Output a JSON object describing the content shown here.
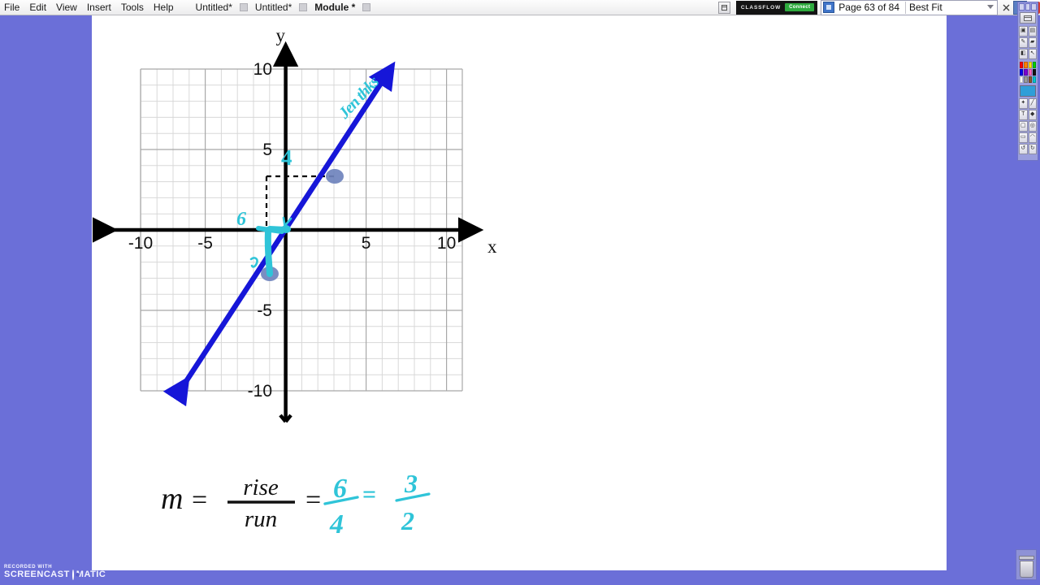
{
  "window": {
    "menus": [
      "File",
      "Edit",
      "View",
      "Insert",
      "Tools",
      "Help"
    ],
    "document_tabs": [
      {
        "label": "Untitled*",
        "bold": false
      },
      {
        "label": "Untitled*",
        "bold": false
      },
      {
        "label": "Module *",
        "bold": true
      }
    ],
    "classflow": {
      "brand": "CLASSFLOW",
      "button": "Connect"
    },
    "page_nav": {
      "label": "Page 63 of 84",
      "zoom_mode": "Best Fit"
    },
    "window_buttons": [
      "minimize",
      "restore",
      "close"
    ]
  },
  "toolbar": {
    "title": "toolbox",
    "tools": [
      "select-tool",
      "eraser-tool",
      "pen-tool",
      "highlighter-tool",
      "shape-tool",
      "pointer-tool",
      "stamp-tool",
      "line-tool",
      "text-tool",
      "fill-tool",
      "image-tool",
      "camera-tool",
      "ruler-tool",
      "protractor-tool",
      "undo-tool",
      "redo-tool"
    ],
    "palette": [
      "#ff0000",
      "#ff7f00",
      "#ffe600",
      "#00d000",
      "#0000ee",
      "#7a00d0",
      "#ff60c0",
      "#111111",
      "#ffffff",
      "#9a9a9a",
      "#8a5a2b",
      "#00c8d0"
    ],
    "active_color": "#2f9ed8",
    "secondary_color": "#111111"
  },
  "watermark": {
    "top": "RECORDED WITH",
    "main_left": "SCREENCAST",
    "main_right": "MATIC"
  },
  "chart_data": {
    "type": "line",
    "title": "",
    "xlabel": "x",
    "ylabel": "y",
    "xlim": [
      -10,
      10
    ],
    "ylim": [
      -10,
      10
    ],
    "xticks": [
      -10,
      -5,
      5,
      10
    ],
    "yticks": [
      10,
      5,
      -5,
      -10
    ],
    "xtick_labels": [
      "-10",
      "-5",
      "5",
      "10"
    ],
    "ytick_labels": [
      "10",
      "5",
      "-5",
      "-10"
    ],
    "grid": true,
    "grid_step": 1,
    "major_grid_step": 5,
    "line_color": "#1616d8",
    "series": [
      {
        "name": "line",
        "equation_slope": 1.5,
        "points": [
          {
            "x": -1.2,
            "y": -3.0,
            "marker": true
          },
          {
            "x": 2.0,
            "y": 3.0,
            "marker": true
          }
        ],
        "arrow_start": {
          "x": -7.6,
          "y": -9.6
        },
        "arrow_end": {
          "x": 7.5,
          "y": 9.6
        }
      }
    ],
    "annotations": [
      {
        "kind": "ink-text",
        "text": "Jen thks",
        "color": "#2fc4d8",
        "x": 5.0,
        "y": 7.0,
        "rotation": -45
      },
      {
        "kind": "ink-label",
        "text": "4",
        "color": "#2fc4d8",
        "x": 0.0,
        "y": 4.2
      },
      {
        "kind": "ink-label",
        "text": "6",
        "color": "#2fc4d8",
        "x": -2.3,
        "y": 0.9
      },
      {
        "kind": "dashed-rise-run",
        "color": "#000000",
        "from": {
          "x": -1.2,
          "y": 3.0
        },
        "to": {
          "x": 2.0,
          "y": 3.0
        }
      },
      {
        "kind": "ink-run-arrow",
        "color": "#2fc4d8",
        "from": {
          "x": -1.2,
          "y": 0.0
        },
        "to": {
          "x": 0.0,
          "y": 0.0
        }
      },
      {
        "kind": "ink-rise-arrow",
        "color": "#2fc4d8",
        "from": {
          "x": -1.2,
          "y": 0.0
        },
        "to": {
          "x": -1.2,
          "y": -3.0
        }
      }
    ]
  },
  "equation": {
    "m": "m",
    "eq1": "=",
    "rise": "rise",
    "run": "run",
    "eq2": "=",
    "ink_numerator": "6",
    "ink_denominator": "4",
    "ink_eq": "=",
    "ink_result_numerator": "3",
    "ink_result_denominator": "2",
    "ink_color": "#2fc4d8"
  }
}
